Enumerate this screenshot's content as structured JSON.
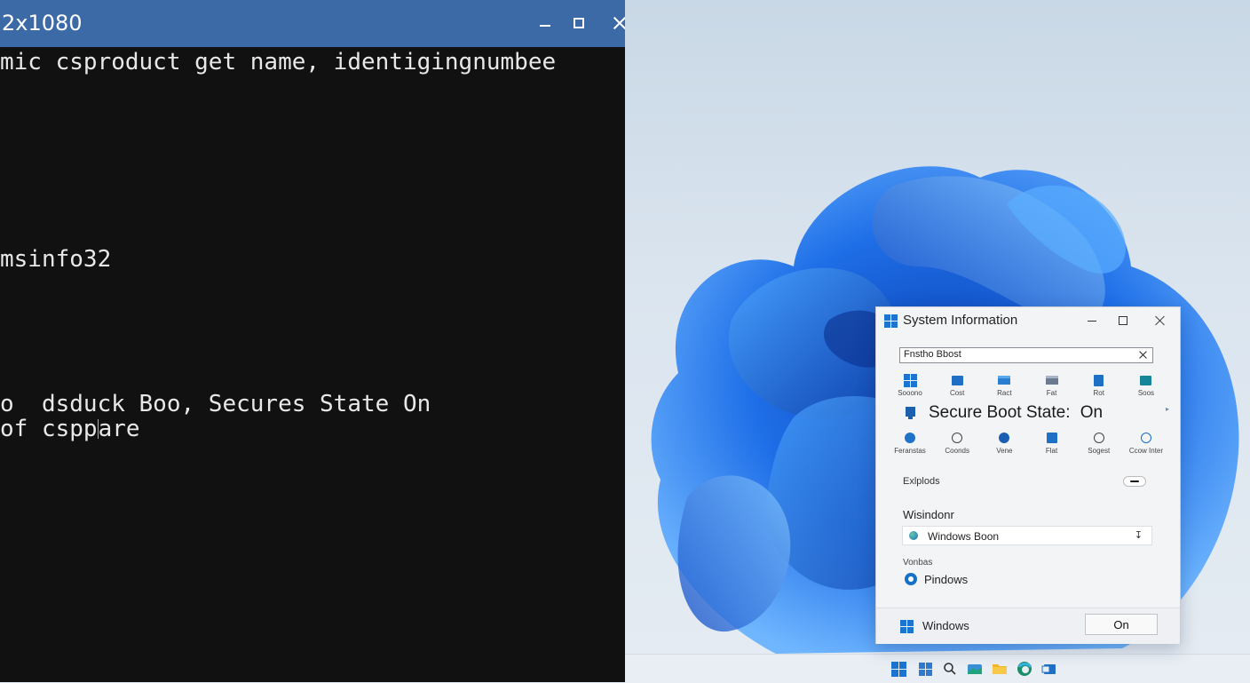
{
  "terminal": {
    "title": "2x1080",
    "lines": [
      "mic csproduct get name, identigingnumbee",
      "msinfo32",
      "o  dsduck Boo, Secures State On",
      "of cspp",
      "are"
    ]
  },
  "sysinfo": {
    "title": "System Information",
    "search_value": "Fnstho Bbost",
    "top_icons": [
      {
        "label": "Sooono",
        "icon": "windows-icon"
      },
      {
        "label": "Cost",
        "icon": "monitor-icon"
      },
      {
        "label": "Ract",
        "icon": "folder-icon"
      },
      {
        "label": "Fat",
        "icon": "folder-icon"
      },
      {
        "label": "Rot",
        "icon": "file-icon"
      },
      {
        "label": "Soos",
        "icon": "monitor-icon"
      }
    ],
    "secure_label": "Secure Boot State:",
    "secure_value": "On",
    "mid_icons": [
      {
        "label": "Feranstas",
        "icon": "globe-icon"
      },
      {
        "label": "Coonds",
        "icon": "settings-icon"
      },
      {
        "label": "Vene",
        "icon": "shield-icon"
      },
      {
        "label": "Flat",
        "icon": "file-icon"
      },
      {
        "label": "Sogest",
        "icon": "settings-icon"
      },
      {
        "label": "Ccow Inter",
        "icon": "refresh-icon"
      }
    ],
    "explore_label": "Exlplods",
    "section_heading": "Wisindonr",
    "select_value": "Windows Boon",
    "vorbas_label": "Vonbas",
    "radio_label": "Pindows",
    "footer_label": "Windows",
    "footer_button": "On"
  },
  "taskbar": {
    "icons": [
      "start-icon",
      "widgets-icon",
      "search-icon",
      "photos-icon",
      "file-explorer-icon",
      "edge-icon",
      "store-icon"
    ]
  },
  "colors": {
    "terminal_bg": "#111112",
    "terminal_titlebar": "#3b6aa6",
    "accent": "#1670c6"
  }
}
